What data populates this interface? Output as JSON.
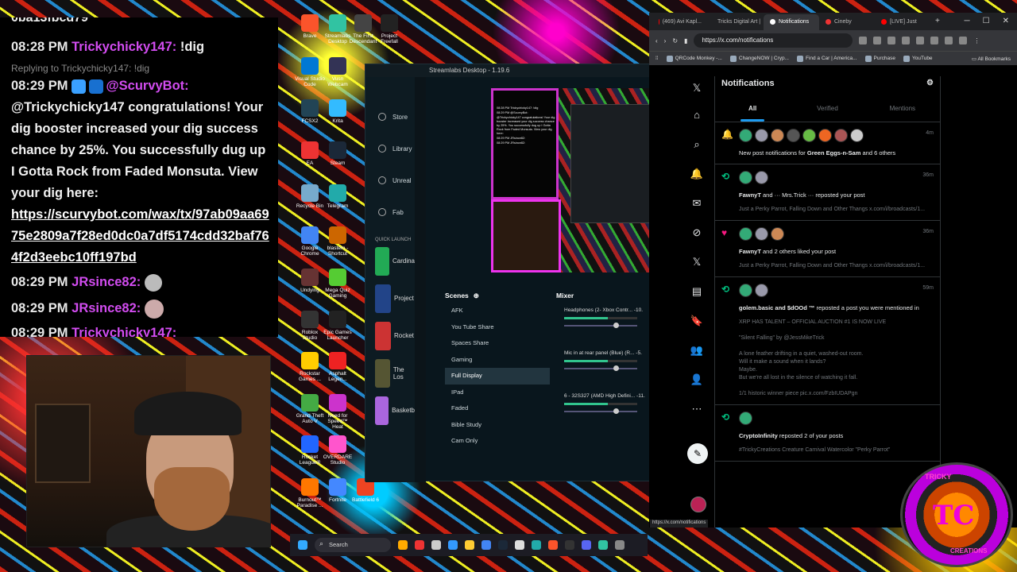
{
  "chat": {
    "top_fragment": "0ba13fbcd79",
    "messages": [
      {
        "time": "08:28 PM",
        "user": "Trickychicky147:",
        "text": "!dig"
      },
      {
        "reply": "Replying to Trickychicky147: !dig",
        "time": "08:29 PM",
        "user": "@ScurvyBot:",
        "text": "@Trickychicky147 congratulations! Your dig booster increased your dig success chance by 25%. You successfully dug up I Gotta Rock from Faded Monsuta. View your dig here:",
        "link": "https://scurvybot.com/wax/tx/97ab09aa6975e2809a7f28ed0dc0a7df5174cdd32baf764f2d3eebc10ff197bd"
      },
      {
        "time": "08:29 PM",
        "user": "JRsince82:"
      },
      {
        "time": "08:29 PM",
        "user": "JRsince82:"
      },
      {
        "time": "08:29 PM",
        "user": "Trickychicky147:"
      }
    ]
  },
  "desktop_icons": [
    {
      "label": "Brave",
      "color": "#fb542b"
    },
    {
      "label": "Streamlabs Desktop",
      "color": "#31c3a2"
    },
    {
      "label": "The First Descendant",
      "color": "#444"
    },
    {
      "label": "Project Freefall",
      "color": "#222"
    },
    {
      "label": "Visual Studio Code",
      "color": "#0078d4"
    },
    {
      "label": "Vusn Webcam",
      "color": "#335"
    },
    {
      "label": "FCSX2",
      "color": "#245"
    },
    {
      "label": "Krita",
      "color": "#3bf"
    },
    {
      "label": "EA",
      "color": "#e33"
    },
    {
      "label": "Steam",
      "color": "#1b2838"
    },
    {
      "label": "Recycle Bin",
      "color": "#7ac"
    },
    {
      "label": "Telegram",
      "color": "#2aa"
    },
    {
      "label": "Google Chrome",
      "color": "#4285f4"
    },
    {
      "label": "blastem - Shortcut",
      "color": "#c60"
    },
    {
      "label": "Undying",
      "color": "#633"
    },
    {
      "label": "Mega Quiz Gaming",
      "color": "#5c3"
    },
    {
      "label": "Roblox Studio",
      "color": "#333"
    },
    {
      "label": "Epic Games Launcher",
      "color": "#222"
    },
    {
      "label": "Rockstar Games ...",
      "color": "#fc0"
    },
    {
      "label": "Asphalt Legen...",
      "color": "#e22"
    },
    {
      "label": "Grand Theft Auto V",
      "color": "#4a4"
    },
    {
      "label": "Need for Speed™ Heat",
      "color": "#c3c"
    },
    {
      "label": "Rocket League®",
      "color": "#26f"
    },
    {
      "label": "OVERDARE Studio",
      "color": "#f5c"
    },
    {
      "label": "Burnout™ Paradise ...",
      "color": "#f70"
    },
    {
      "label": "Fortnite",
      "color": "#48f"
    },
    {
      "label": "Battlefield 6",
      "color": "#e42"
    }
  ],
  "streamlabs": {
    "title": "Streamlabs Desktop - 1.19.6",
    "nav": [
      "Store",
      "Library",
      "Unreal",
      "Fab"
    ],
    "quick_launch": "QUICK LAUNCH",
    "games": [
      {
        "label": "Cardina",
        "color": "#2a5"
      },
      {
        "label": "Project",
        "color": "#248"
      },
      {
        "label": "Rocket",
        "color": "#c33"
      },
      {
        "label": "The Los",
        "color": "#553"
      },
      {
        "label": "Basketb",
        "color": "#a6d"
      }
    ],
    "scenes_header": "Scenes",
    "scenes": [
      "AFK",
      "You Tube Share",
      "Spaces Share",
      "Gaming",
      "Full Display",
      "IPad",
      "Faded",
      "Bible Study",
      "Cam Only"
    ],
    "selected_scene": "Full Display",
    "mixer_header": "Mixer",
    "mixer": [
      {
        "name": "Headphones (2- Xbox Contr...",
        "db": "-10."
      },
      {
        "name": "Mic in at rear panel (Blue) (R...",
        "db": "-5."
      },
      {
        "name": "6 - 32S327 (AMD High Defini...",
        "db": "-11."
      }
    ],
    "preview_text": [
      "08:28 PM Trickychicky147: !dig",
      "08:29 PM @ScurvyBot:",
      "@Trickychicky147 congratulations! Your dig booster increased your dig success chance by 25%. You successfully dug up I Gotta Rock from Faded Monsuta. View your dig here:",
      "08:29 PM JRsince82:",
      "08:29 PM JRsince82:"
    ]
  },
  "browser": {
    "tabs": [
      {
        "label": "(469) Avi Kapl...",
        "color": "#f00"
      },
      {
        "label": "Tricks Digital Art |",
        "color": "#59f"
      },
      {
        "label": "Notifications",
        "color": "#fff"
      },
      {
        "label": "Cineby",
        "color": "#e33"
      },
      {
        "label": "[LIVE] Just",
        "color": "#f00"
      }
    ],
    "active_tab": 2,
    "url": "https://x.com/notifications",
    "bookmarks": [
      "QRCode Monkey -...",
      "ChangeNOW | Cryp...",
      "Find a Car | America...",
      "Purchase",
      "YouTube"
    ],
    "all_bookmarks": "All Bookmarks",
    "status_url": "https://x.com/notifications"
  },
  "x": {
    "header": "Notifications",
    "tabs": [
      "All",
      "Verified",
      "Mentions"
    ],
    "active_tab": "All",
    "nav_icons": [
      "𝕏",
      "⌂",
      "⌕",
      "🔔",
      "✉",
      "⊘",
      "𝕏",
      "▤",
      "🔖",
      "👥",
      "👤",
      "⋯"
    ],
    "notifications": [
      {
        "type": "bell",
        "age": "4m",
        "avatars": 8,
        "text_pre": "New post notifications for ",
        "bold": "Green Eggs-n-Sam",
        "text_post": " and 6 others",
        "sub": ""
      },
      {
        "type": "repost",
        "age": "36m",
        "avatars": 2,
        "text_pre": "",
        "bold": "FawnyT",
        "text_post": " and ··· Mrs.Trick ··· reposted your post",
        "sub": "Just a Perky Parrot, Falling Down and Other Thangs x.com/i/broadcasts/1..."
      },
      {
        "type": "like",
        "age": "36m",
        "avatars": 3,
        "text_pre": "",
        "bold": "FawnyT",
        "text_post": " and 2 others liked your post",
        "sub": "Just a Perky Parrot, Falling Down and Other Thangs x.com/i/broadcasts/1..."
      },
      {
        "type": "repost",
        "age": "59m",
        "avatars": 2,
        "text_pre": "",
        "bold": "golem.basic and $dOOd ™",
        "text_post": " reposted a post you were mentioned in",
        "sub": "XRP HAS TALENT – OFFICIAL AUCTION #1 IS NOW LIVE\n\n\"Silent Falling\" by @JessMikeTrick\n\nA lone feather drifting in a quiet, washed-out room.\nWill it make a sound when it lands?\nMaybe.\nBut we're all lost in the silence of watching it fall.\n\n1/1 historic winner piece pic.x.com/FzbIUDAPgn"
      },
      {
        "type": "repost",
        "age": "",
        "avatars": 1,
        "text_pre": "",
        "bold": "CryptoInfinity",
        "text_post": " reposted 2 of your posts",
        "sub": "#TrickyCreations Creature Carnival Watercolor \"Perky Parrot\""
      }
    ]
  },
  "taskbar": {
    "search": "Search"
  },
  "logo": {
    "ring_top": "TRICKY",
    "letters": "TC",
    "ring_bottom": "CREATIONS"
  },
  "colors": {
    "x_blue": "#1d9bf0",
    "chat_user": "#d24cf0",
    "streamlabs_accent": "#31c48d"
  }
}
